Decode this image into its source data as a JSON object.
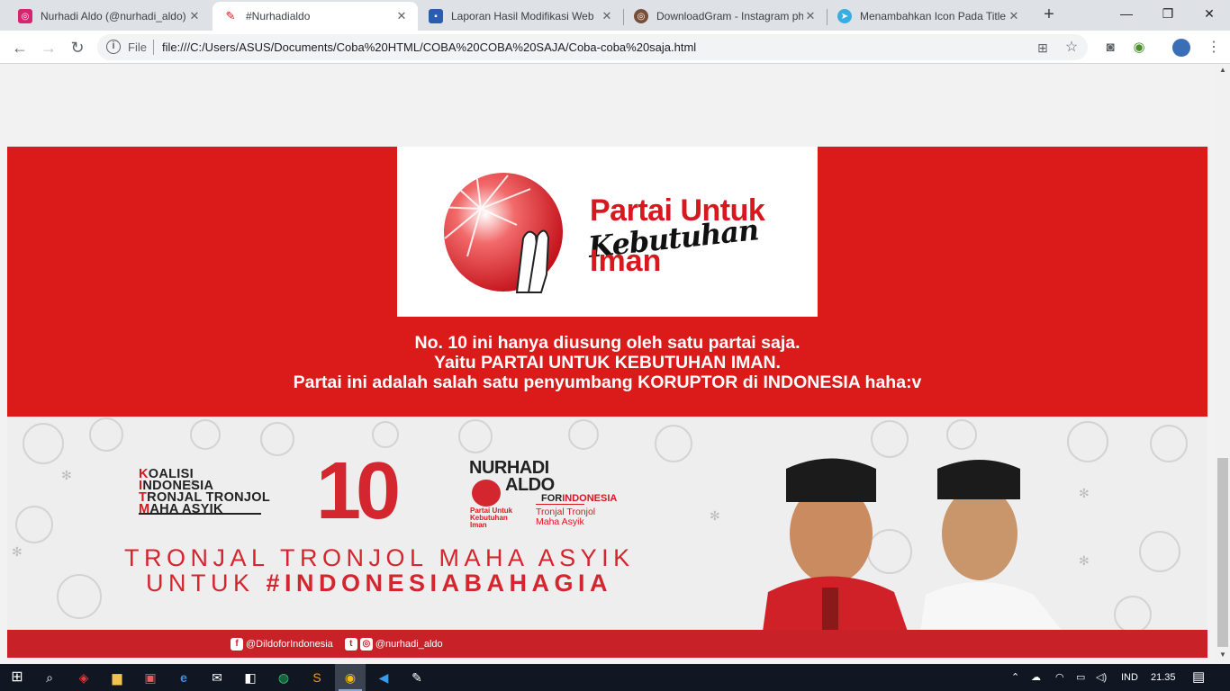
{
  "tabs": [
    {
      "title": "Nurhadi Aldo (@nurhadi_aldo)",
      "icon": "instagram-icon",
      "color": "#d6246e"
    },
    {
      "title": "#Nurhadialdo",
      "icon": "red-brush-icon",
      "color": "#d8181f",
      "active": true
    },
    {
      "title": "Laporan Hasil Modifikasi Web",
      "icon": "document-icon",
      "color": "#2a5db0"
    },
    {
      "title": "DownloadGram - Instagram ph",
      "icon": "downloadgram-icon",
      "color": "#7a4f3a"
    },
    {
      "title": "Menambahkan Icon Pada Title",
      "icon": "telegram-icon",
      "color": "#37aee2"
    }
  ],
  "address": {
    "scheme_label": "File",
    "url": "file:///C:/Users/ASUS/Documents/Coba%20HTML/COBA%20COBA%20SAJA/Coba-coba%20saja.html"
  },
  "logo": {
    "line1": "Partai Untuk",
    "line2": "Kebutuhan",
    "line3": "Iman"
  },
  "message": [
    "No. 10 ini hanya diusung oleh satu partai saja.",
    "Yaitu PARTAI UNTUK KEBUTUHAN IMAN.",
    "Partai ini adalah salah satu penyumbang KORUPTOR di INDONESIA haha:v"
  ],
  "banner": {
    "coalition": [
      {
        "red": "K",
        "rest": "OALISI"
      },
      {
        "red": "I",
        "rest": "NDONESIA"
      },
      {
        "red": "T",
        "rest": "RONJAL TRONJOL",
        "red2": ""
      },
      {
        "red": "M",
        "rest": "AHA ASYIK"
      }
    ],
    "number": "10",
    "candidate_line1": "NURHADI",
    "candidate_line2": "ALDO",
    "for_label": "FOR",
    "for_country": "INDONESIA",
    "sub1": "Tronjal Tronjol",
    "sub2": "Maha Asyik",
    "mini_logo": "Partai Untuk Kebutuhan Iman",
    "slogan1": "TRONJAL TRONJOL MAHA ASYIK",
    "slogan2_prefix": "UNTUK ",
    "slogan2_tag": "#INDONESIABAHAGIA",
    "facebook": "@DildoforIndonesia",
    "instagram": "@nurhadi_aldo"
  },
  "tray": {
    "language": "IND",
    "time": "21.35"
  },
  "colors": {
    "brand_red": "#db1a1a",
    "banner_red": "#c92128"
  }
}
